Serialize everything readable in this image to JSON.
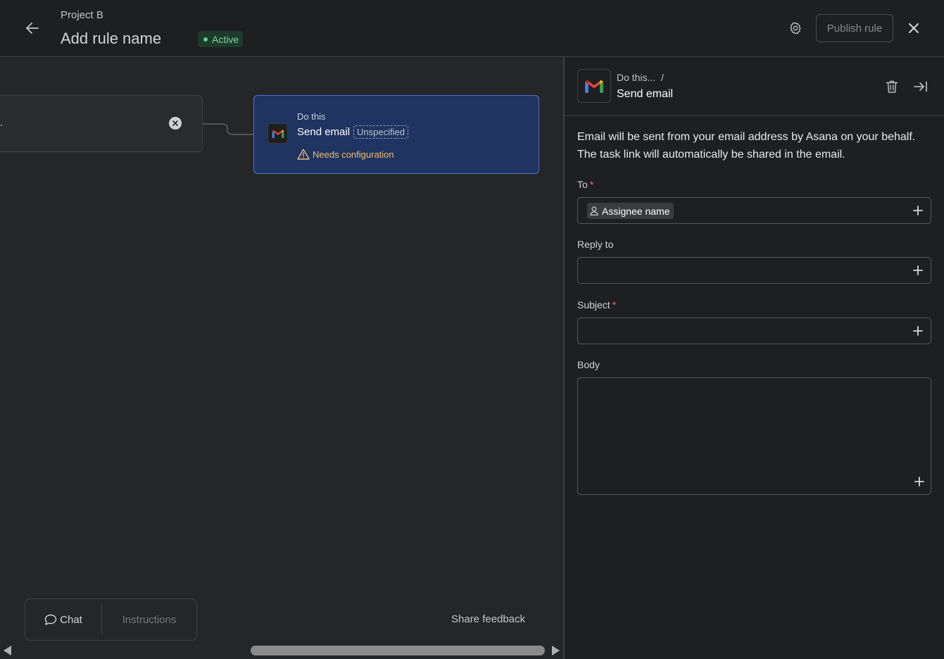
{
  "header": {
    "project_name": "Project B",
    "rule_name": "Add rule name",
    "status": "Active",
    "publish_label": "Publish rule"
  },
  "canvas": {
    "trigger_card": {
      "text": "."
    },
    "action_card": {
      "kicker": "Do this",
      "title": "Send email",
      "chip": "Unspecified",
      "warning": "Needs configuration"
    },
    "bottom_tabs": {
      "chat": "Chat",
      "instructions": "Instructions"
    },
    "share_feedback": "Share feedback"
  },
  "panel": {
    "breadcrumb": "Do this...  /",
    "title": "Send email",
    "description": "Email will be sent from your email address by Asana on your behalf. The task link will automatically be shared in the email.",
    "fields": {
      "to": {
        "label": "To",
        "required": "*",
        "token": "Assignee name"
      },
      "reply_to": {
        "label": "Reply to"
      },
      "subject": {
        "label": "Subject",
        "required": "*"
      },
      "body": {
        "label": "Body"
      }
    }
  },
  "colors": {
    "accent_blue": "#4f73c4",
    "action_card_bg": "#1f3460",
    "status_green": "#5bd08f",
    "warning": "#f1bd6c",
    "required": "#f06a6a"
  },
  "icons": {
    "back": "arrow-left-icon",
    "settings": "gear-icon",
    "close": "close-icon",
    "gmail": "gmail-icon",
    "delete": "trash-icon",
    "collapse": "collapse-panel-icon",
    "warning": "warning-icon",
    "chat": "chat-bubble-icon",
    "person": "person-icon",
    "add": "plus-icon"
  }
}
